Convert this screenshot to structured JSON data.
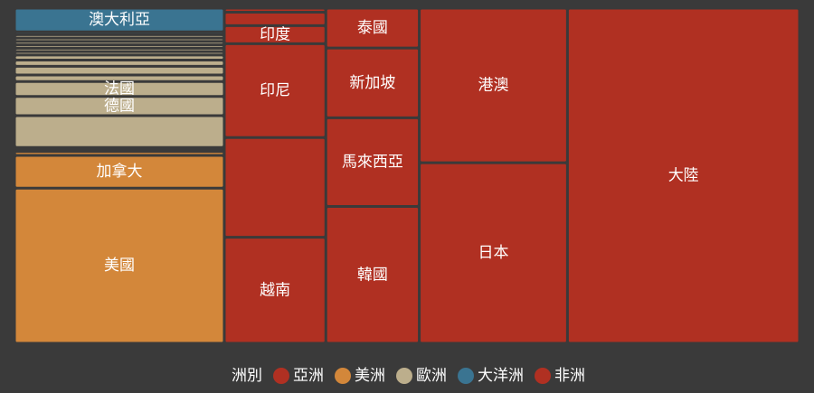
{
  "colors": {
    "background": "#3a3a3a",
    "asia": "#b03022",
    "americas": "#d3873a",
    "europe": "#bcae8c",
    "oceania": "#3a7491",
    "africa": "#b03022"
  },
  "chart_data": {
    "type": "treemap",
    "legend": {
      "title": "洲別",
      "placement": "bottom-center",
      "items": [
        {
          "key": "asia",
          "label": "亞洲",
          "color": "#b03022"
        },
        {
          "key": "americas",
          "label": "美洲",
          "color": "#d3873a"
        },
        {
          "key": "europe",
          "label": "歐洲",
          "color": "#bcae8c"
        },
        {
          "key": "oceania",
          "label": "大洋洲",
          "color": "#3a7491"
        },
        {
          "key": "africa",
          "label": "非洲",
          "color": "#b03022"
        }
      ]
    },
    "groups": [
      {
        "key": "rest",
        "items": [
          {
            "key": "oceania",
            "label": "澳大利亞",
            "value": 8.4
          },
          {
            "key": "oceania",
            "label": "",
            "value": 1.0
          },
          {
            "key": "europe",
            "label": "",
            "value": 1.2
          },
          {
            "key": "europe",
            "label": "",
            "value": 1.2
          },
          {
            "key": "europe",
            "label": "",
            "value": 1.2
          },
          {
            "key": "europe",
            "label": "",
            "value": 1.2
          },
          {
            "key": "europe",
            "label": "",
            "value": 1.2
          },
          {
            "key": "europe",
            "label": "",
            "value": 1.2
          },
          {
            "key": "europe",
            "label": "",
            "value": 1.8
          },
          {
            "key": "europe",
            "label": "",
            "value": 2.2
          },
          {
            "key": "europe",
            "label": "",
            "value": 3.1
          },
          {
            "key": "europe",
            "label": "",
            "value": 2.3
          },
          {
            "key": "europe",
            "label": "法國",
            "value": 5.3
          },
          {
            "key": "europe",
            "label": "德國",
            "value": 6.8
          },
          {
            "key": "europe",
            "label": "",
            "value": 11.3
          },
          {
            "key": "americas",
            "label": "",
            "value": 0.7
          },
          {
            "key": "americas",
            "label": "",
            "value": 0.7
          },
          {
            "key": "americas",
            "label": "",
            "value": 1.4
          },
          {
            "key": "americas",
            "label": "加拿大",
            "value": 11.6
          },
          {
            "key": "americas",
            "label": "美國",
            "value": 55.0
          }
        ]
      },
      {
        "key": "asia-small",
        "items": [
          {
            "key": "asia",
            "label": "",
            "value": 0.7
          },
          {
            "key": "asia",
            "label": "",
            "value": 2.3
          },
          {
            "key": "asia",
            "label": "印度",
            "value": 3.1
          },
          {
            "key": "asia",
            "label": "印尼",
            "value": 16.1
          },
          {
            "key": "asia",
            "label": "",
            "value": 17.1
          },
          {
            "key": "asia",
            "label": "越南",
            "value": 18.2
          }
        ]
      },
      {
        "key": "asia-mid",
        "items": [
          {
            "key": "asia",
            "label": "泰國",
            "value": 6.3
          },
          {
            "key": "asia",
            "label": "新加坡",
            "value": 11.0
          },
          {
            "key": "asia",
            "label": "馬來西亞",
            "value": 14.0
          },
          {
            "key": "asia",
            "label": "韓國",
            "value": 21.6
          }
        ]
      },
      {
        "key": "asia-large",
        "items": [
          {
            "key": "asia",
            "label": "港澳",
            "value": 38.7
          },
          {
            "key": "asia",
            "label": "日本",
            "value": 45.2
          }
        ]
      },
      {
        "key": "asia-largest",
        "items": [
          {
            "key": "asia",
            "label": "大陸",
            "value": 131.4
          }
        ]
      }
    ]
  }
}
